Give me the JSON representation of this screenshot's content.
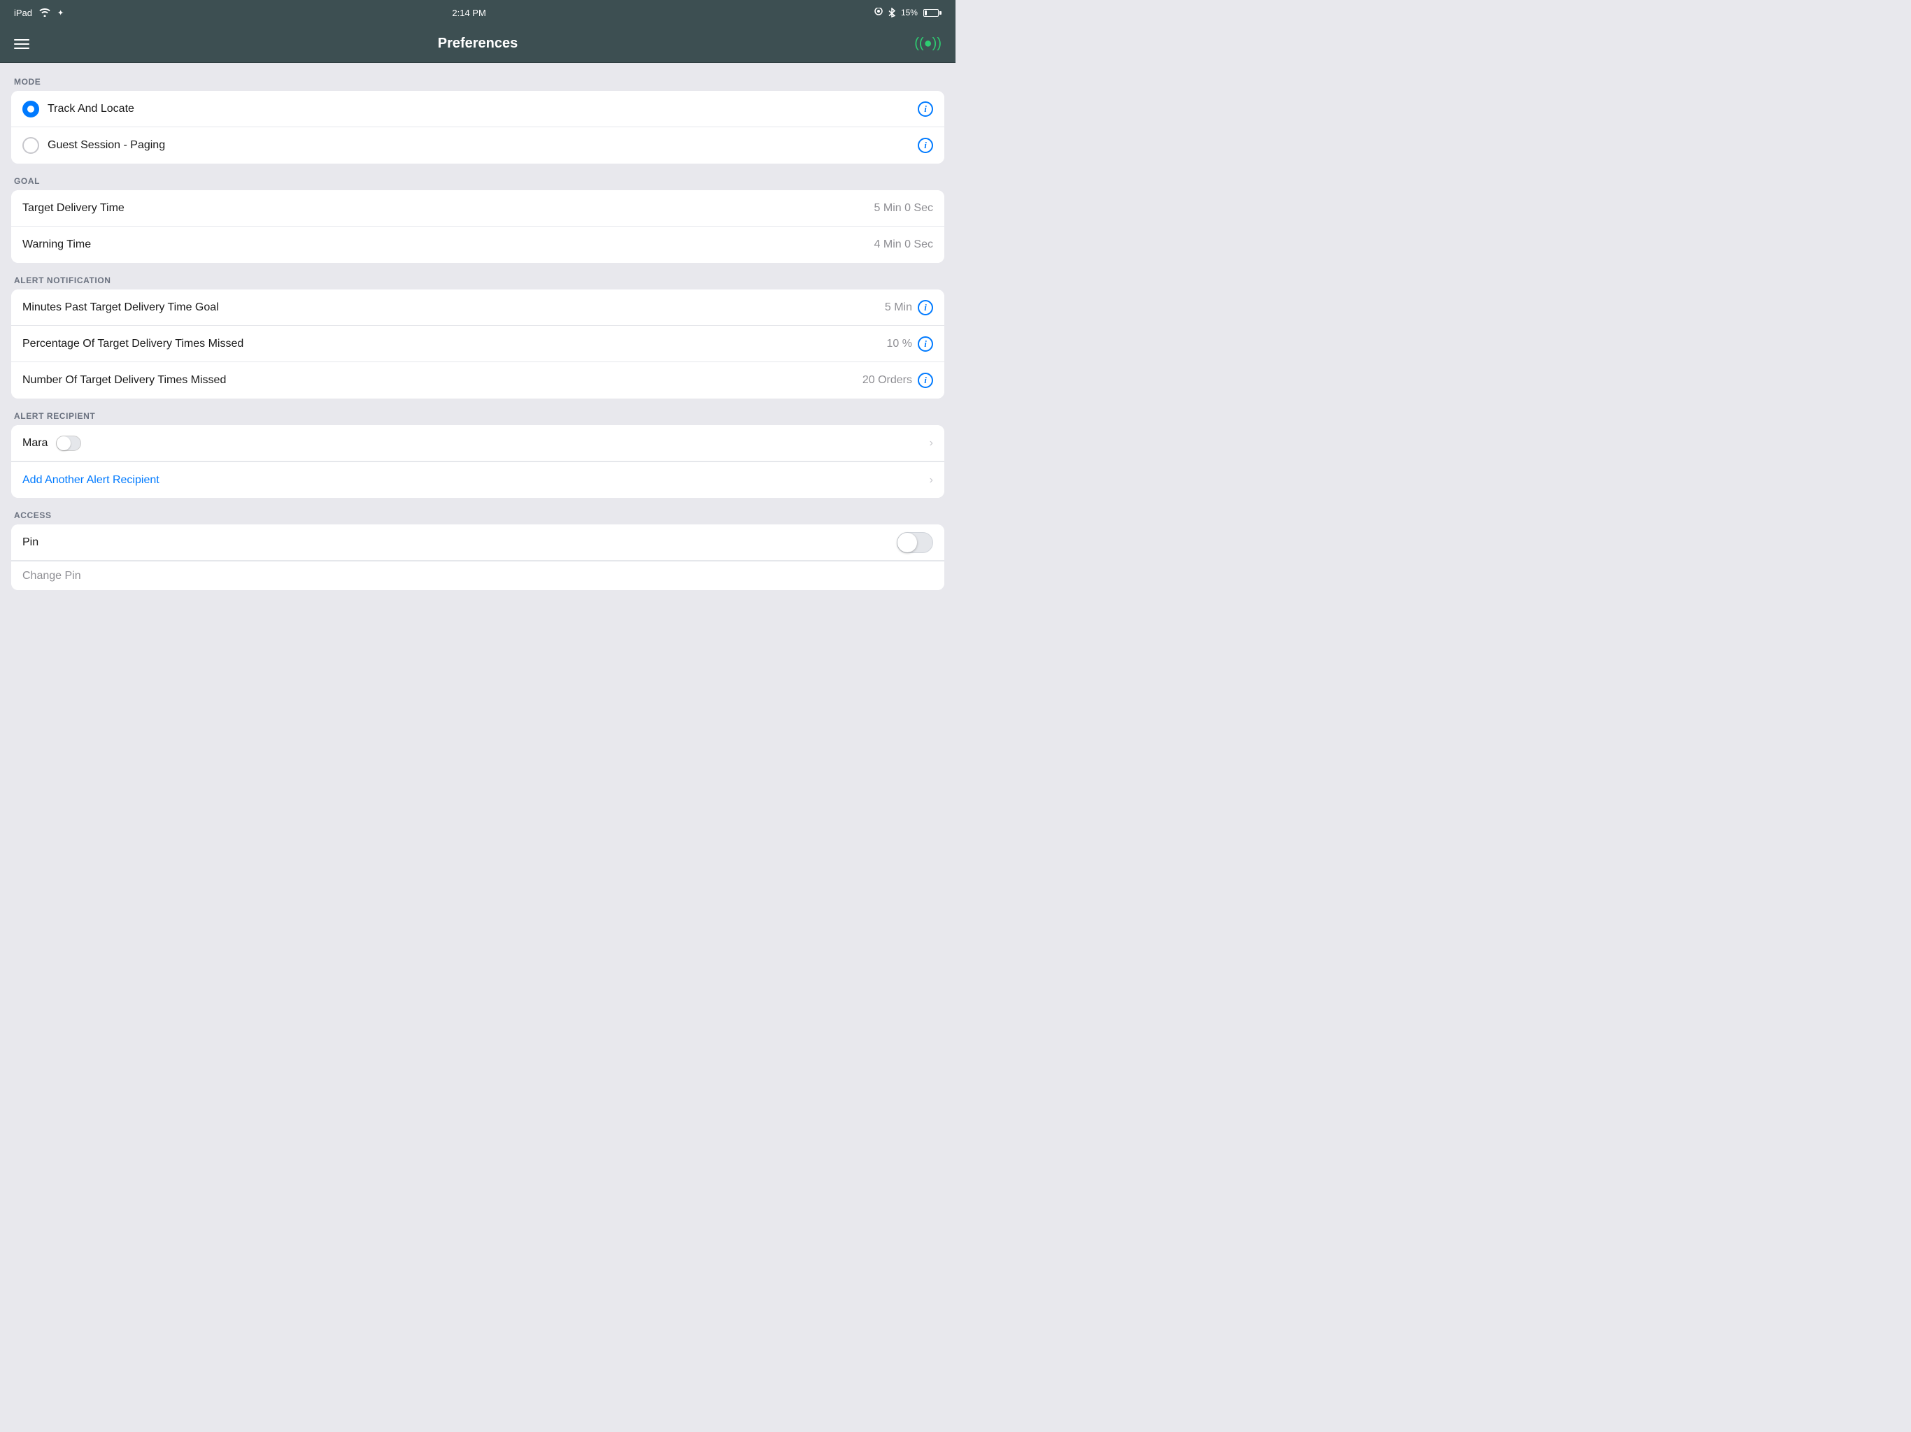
{
  "statusBar": {
    "left": "iPad",
    "time": "2:14 PM",
    "battery": "15%",
    "wifiIcon": "wifi-icon",
    "batteryIcon": "battery-icon"
  },
  "navBar": {
    "title": "Preferences",
    "menuIcon": "menu-icon",
    "broadcastIcon": "broadcast-icon"
  },
  "sections": {
    "mode": {
      "label": "MODE",
      "options": [
        {
          "id": "track-and-locate",
          "label": "Track And Locate",
          "selected": true
        },
        {
          "id": "guest-session-paging",
          "label": "Guest Session - Paging",
          "selected": false
        }
      ]
    },
    "goal": {
      "label": "GOAL",
      "rows": [
        {
          "id": "target-delivery-time",
          "label": "Target Delivery Time",
          "value": "5 Min 0 Sec"
        },
        {
          "id": "warning-time",
          "label": "Warning Time",
          "value": "4 Min 0 Sec"
        }
      ]
    },
    "alertNotification": {
      "label": "ALERT NOTIFICATION",
      "rows": [
        {
          "id": "minutes-past",
          "label": "Minutes Past Target Delivery Time Goal",
          "value": "5 Min",
          "hasInfo": true
        },
        {
          "id": "percentage-missed",
          "label": "Percentage Of Target Delivery Times Missed",
          "value": "10 %",
          "hasInfo": true
        },
        {
          "id": "number-missed",
          "label": "Number Of Target Delivery Times Missed",
          "value": "20 Orders",
          "hasInfo": true
        }
      ]
    },
    "alertRecipient": {
      "label": "ALERT RECIPIENT",
      "recipients": [
        {
          "id": "mara",
          "name": "Mara",
          "toggleOn": false
        }
      ],
      "addLabel": "Add Another Alert Recipient"
    },
    "access": {
      "label": "ACCESS",
      "rows": [
        {
          "id": "pin",
          "label": "Pin",
          "toggleOn": false
        },
        {
          "id": "change-pin",
          "label": "Change Pin",
          "partial": true
        }
      ]
    }
  }
}
